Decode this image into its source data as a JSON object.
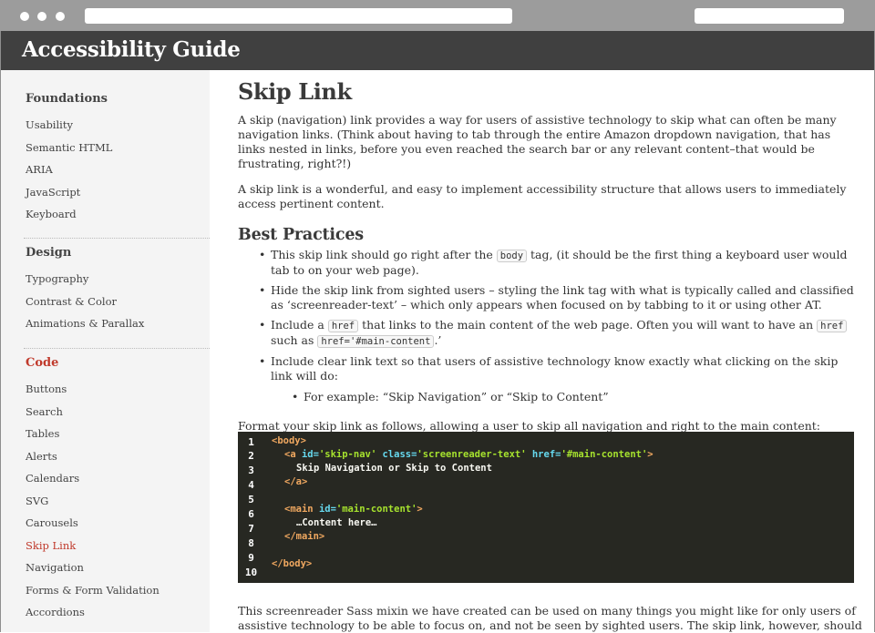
{
  "site": {
    "title": "Accessibility Guide"
  },
  "sidebar": {
    "sections": [
      {
        "heading": "Foundations",
        "items": [
          "Usability",
          "Semantic HTML",
          "ARIA",
          "JavaScript",
          "Keyboard"
        ]
      },
      {
        "heading": "Design",
        "items": [
          "Typography",
          "Contrast & Color",
          "Animations & Parallax"
        ]
      },
      {
        "heading": "Code",
        "items": [
          "Buttons",
          "Search",
          "Tables",
          "Alerts",
          "Calendars",
          "SVG",
          "Carousels",
          "Skip Link",
          "Navigation",
          "Forms & Form Validation",
          "Accordions"
        ]
      }
    ],
    "active_item": "Skip Link"
  },
  "main": {
    "title": "Skip Link",
    "intro": "A skip (navigation) link provides a way for users of assistive technology to skip what can often be many navigation links. (Think about having to tab through the entire Amazon dropdown navigation, that has links nested in links, before you even reached the search bar or any relevant content–that would be frustrating, right?!)",
    "intro2": "A skip link is a wonderful, and easy to implement accessibility structure that allows users to immediately access pertinent content.",
    "best_practices_heading": "Best Practices",
    "bp1_before": "This skip link should go right after the ",
    "bp1_code": "body",
    "bp1_after": " tag, (it should be the first thing a keyboard user would tab to on your web page).",
    "bp2": "Hide the skip link from sighted users – styling the link tag with what is typically called and classified as ‘screenreader-text’ – which only appears when focused on by tabbing to it or using other AT.",
    "bp3_a": "Include a ",
    "bp3_code1": "href",
    "bp3_b": " that links to the main content of the web page. Often you will want to have an ",
    "bp3_code2": "href",
    "bp3_c": " such as ",
    "bp3_code3": "href='#main-content",
    "bp3_d": ".’",
    "bp4": "Include clear link text so that users of assistive technology know exactly what clicking on the skip link will do:",
    "bp4_sub": "For example: “Skip Navigation” or “Skip to Content”",
    "format_text": "Format your skip link as follows, allowing a user to skip all navigation and right to the main content:",
    "bottom_text_1": "This screenreader Sass mixin we have created can be used on many things you might like for only users of",
    "bottom_text_2": "assistive technology to be able to focus on, and not be seen by sighted users. The skip link, however, should"
  },
  "code": {
    "line_numbers": [
      "1",
      "2",
      "3",
      "4",
      "5",
      "6",
      "7",
      "8",
      "9",
      "10"
    ],
    "l1_tag": "<body>",
    "l2_open": "<a ",
    "l2_id_attr": "id=",
    "l2_id_val": "'skip-nav'",
    "l2_class_attr": "class=",
    "l2_class_val": "'screenreader-text'",
    "l2_href_attr": "href=",
    "l2_href_val": "'#main-content'",
    "l2_close": ">",
    "l3_text": "Skip Navigation or Skip to Content",
    "l4_tag": "</a>",
    "l6_open": "<main ",
    "l6_id_attr": "id=",
    "l6_id_val": "'main-content'",
    "l6_close": ">",
    "l7_text": "…Content here…",
    "l8_tag": "</main>",
    "l10_tag": "</body>"
  }
}
